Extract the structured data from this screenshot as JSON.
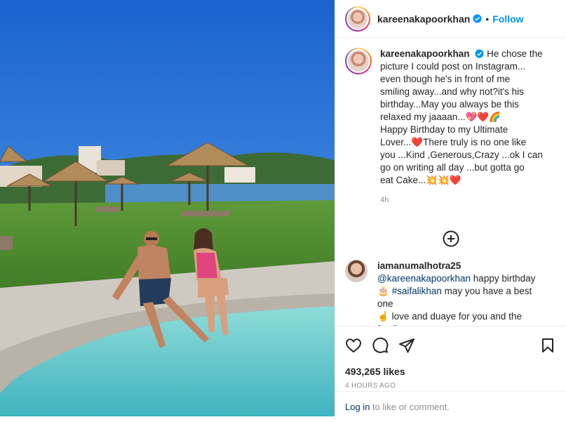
{
  "post": {
    "photo_alt": "Couple sitting at the edge of a pool",
    "author": "kareenakapoorkhan",
    "follow_label": "Follow",
    "separator": "•",
    "caption": {
      "username": "kareenakapoorkhan",
      "lines": [
        "He chose the",
        "picture I could post on Instagram...",
        "even though he's in front of me",
        "smiling away...and why not?it's his",
        "birthday...May you always be this",
        "relaxed my jaaaan...💖❤️🌈",
        "Happy Birthday to my Ultimate",
        "Lover...❤️There truly is no one like",
        "you ...Kind ,Generous,Crazy ...ok I can",
        "go on writing all day ...but gotta go",
        "eat Cake...💥💥❤️"
      ],
      "age": "4h"
    },
    "comment": {
      "username": "iamanumalhotra25",
      "mention": "@kareenakapoorkhan",
      "text1": " happy birthday",
      "emoji1": "🎂",
      "hashtag": "#saifalikhan",
      "text2": " may you have a best one",
      "emoji2": "☝️",
      "text3": " love and duaye for you and the family",
      "emoji3": "❤️"
    },
    "likes": "493,265 likes",
    "posted": "4 HOURS AGO",
    "login_link": "Log in",
    "login_text": " to like or comment."
  },
  "icons": {
    "like": "heart-icon",
    "comment": "comment-icon",
    "share": "share-icon",
    "save": "bookmark-icon",
    "load_more": "plus-circle-icon",
    "verified": "verified-badge-icon"
  },
  "colors": {
    "accent": "#0095f6",
    "link": "#00376b",
    "muted": "#8e8e8e",
    "heart": "#e0245e"
  }
}
